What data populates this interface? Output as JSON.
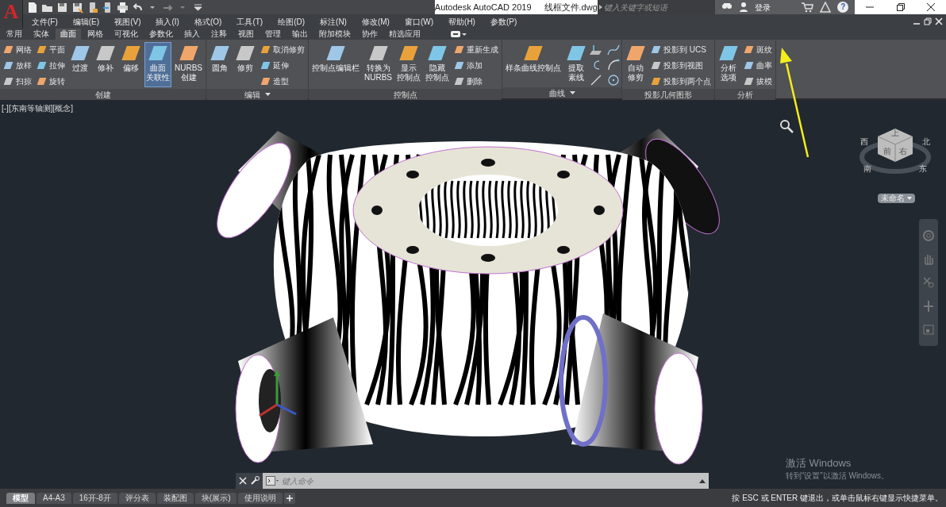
{
  "app_button": {
    "label": "A"
  },
  "window": {
    "title": "Autodesk AutoCAD 2019",
    "file": "线框文件.dwg"
  },
  "search": {
    "placeholder": "键入关键字或短语"
  },
  "sign_in": "登录",
  "help_button": {
    "label": "?"
  },
  "menu_bar": [
    "文件(F)",
    "编辑(E)",
    "视图(V)",
    "插入(I)",
    "格式(O)",
    "工具(T)",
    "绘图(D)",
    "标注(N)",
    "修改(M)",
    "窗口(W)",
    "帮助(H)",
    "参数(P)"
  ],
  "ribbon_tabs": [
    {
      "label": "常用",
      "selected": false
    },
    {
      "label": "实体",
      "selected": false
    },
    {
      "label": "曲面",
      "selected": true
    },
    {
      "label": "网格",
      "selected": false
    },
    {
      "label": "可视化",
      "selected": false
    },
    {
      "label": "参数化",
      "selected": false
    },
    {
      "label": "插入",
      "selected": false
    },
    {
      "label": "注释",
      "selected": false
    },
    {
      "label": "视图",
      "selected": false
    },
    {
      "label": "管理",
      "selected": false
    },
    {
      "label": "输出",
      "selected": false
    },
    {
      "label": "附加模块",
      "selected": false
    },
    {
      "label": "协作",
      "selected": false
    },
    {
      "label": "精选应用",
      "selected": false
    }
  ],
  "ribbon_panels": [
    {
      "title": "创建",
      "has_menu": false,
      "groups": [
        {
          "kind": "stack",
          "items": [
            "网络",
            "放样",
            "扫掠"
          ]
        },
        {
          "kind": "stack",
          "items": [
            "平面",
            "拉伸",
            "旋转"
          ]
        },
        {
          "kind": "large",
          "lines": [
            "过渡"
          ],
          "on": false
        },
        {
          "kind": "large",
          "lines": [
            "修补"
          ],
          "on": false
        },
        {
          "kind": "large",
          "lines": [
            "偏移"
          ],
          "on": false
        },
        {
          "kind": "large",
          "lines": [
            "曲面",
            "关联性"
          ],
          "on": true
        },
        {
          "kind": "large",
          "lines": [
            "NURBS",
            "创建"
          ],
          "on": false
        }
      ]
    },
    {
      "title": "编辑",
      "has_menu": true,
      "groups": [
        {
          "kind": "large",
          "lines": [
            "圆角"
          ],
          "on": false
        },
        {
          "kind": "large",
          "lines": [
            "修剪"
          ],
          "on": false
        },
        {
          "kind": "stack",
          "items": [
            "取消修剪",
            "延伸",
            "造型"
          ]
        }
      ]
    },
    {
      "title": "控制点",
      "has_menu": false,
      "groups": [
        {
          "kind": "large",
          "lines": [
            "控制点编辑栏"
          ],
          "on": false
        },
        {
          "kind": "large",
          "lines": [
            "转换为",
            "NURBS"
          ],
          "on": false
        },
        {
          "kind": "large",
          "lines": [
            "显示",
            "控制点"
          ],
          "on": false
        },
        {
          "kind": "large",
          "lines": [
            "隐藏",
            "控制点"
          ],
          "on": false
        },
        {
          "kind": "stack",
          "items": [
            "重新生成",
            "添加",
            "删除"
          ]
        }
      ]
    },
    {
      "title": "曲线",
      "has_menu": true,
      "groups": [
        {
          "kind": "large",
          "lines": [
            "样条曲线控制点"
          ],
          "on": false
        },
        {
          "kind": "large",
          "lines": [
            "提取",
            "素线"
          ],
          "on": false
        },
        {
          "kind": "icon_grid"
        }
      ]
    },
    {
      "title": "投影几何图形",
      "has_menu": false,
      "groups": [
        {
          "kind": "large",
          "lines": [
            "自动",
            "修剪"
          ],
          "on": false
        },
        {
          "kind": "stack",
          "items": [
            "投影到 UCS",
            "投影到视图",
            "投影到两个点"
          ]
        }
      ]
    },
    {
      "title": "分析",
      "has_menu": false,
      "groups": [
        {
          "kind": "large",
          "lines": [
            "分析",
            "选项"
          ],
          "on": false
        },
        {
          "kind": "stack",
          "items": [
            "斑纹",
            "曲率",
            "拔模"
          ]
        }
      ]
    }
  ],
  "viewport": {
    "label": "[-][东南等轴测][概念]",
    "cube_faces": [
      "上",
      "前",
      "右"
    ],
    "compass": [
      "西",
      "北",
      "南",
      "东"
    ],
    "ucs_menu": "未命名"
  },
  "command_line": {
    "placeholder": "键入命令"
  },
  "layout_tabs": [
    {
      "label": "模型",
      "selected": true
    },
    {
      "label": "A4-A3",
      "selected": false
    },
    {
      "label": "16开-8开",
      "selected": false
    },
    {
      "label": "评分表",
      "selected": false
    },
    {
      "label": "装配图",
      "selected": false
    },
    {
      "label": "块(展示)",
      "selected": false
    },
    {
      "label": "使用说明",
      "selected": false
    }
  ],
  "windows_activation": {
    "title": "激活 Windows",
    "hint": "转到“设置”以激活 Windows。"
  },
  "status_bar": "按 ESC 或 ENTER 键退出，或单击鼠标右键显示快捷菜单。"
}
